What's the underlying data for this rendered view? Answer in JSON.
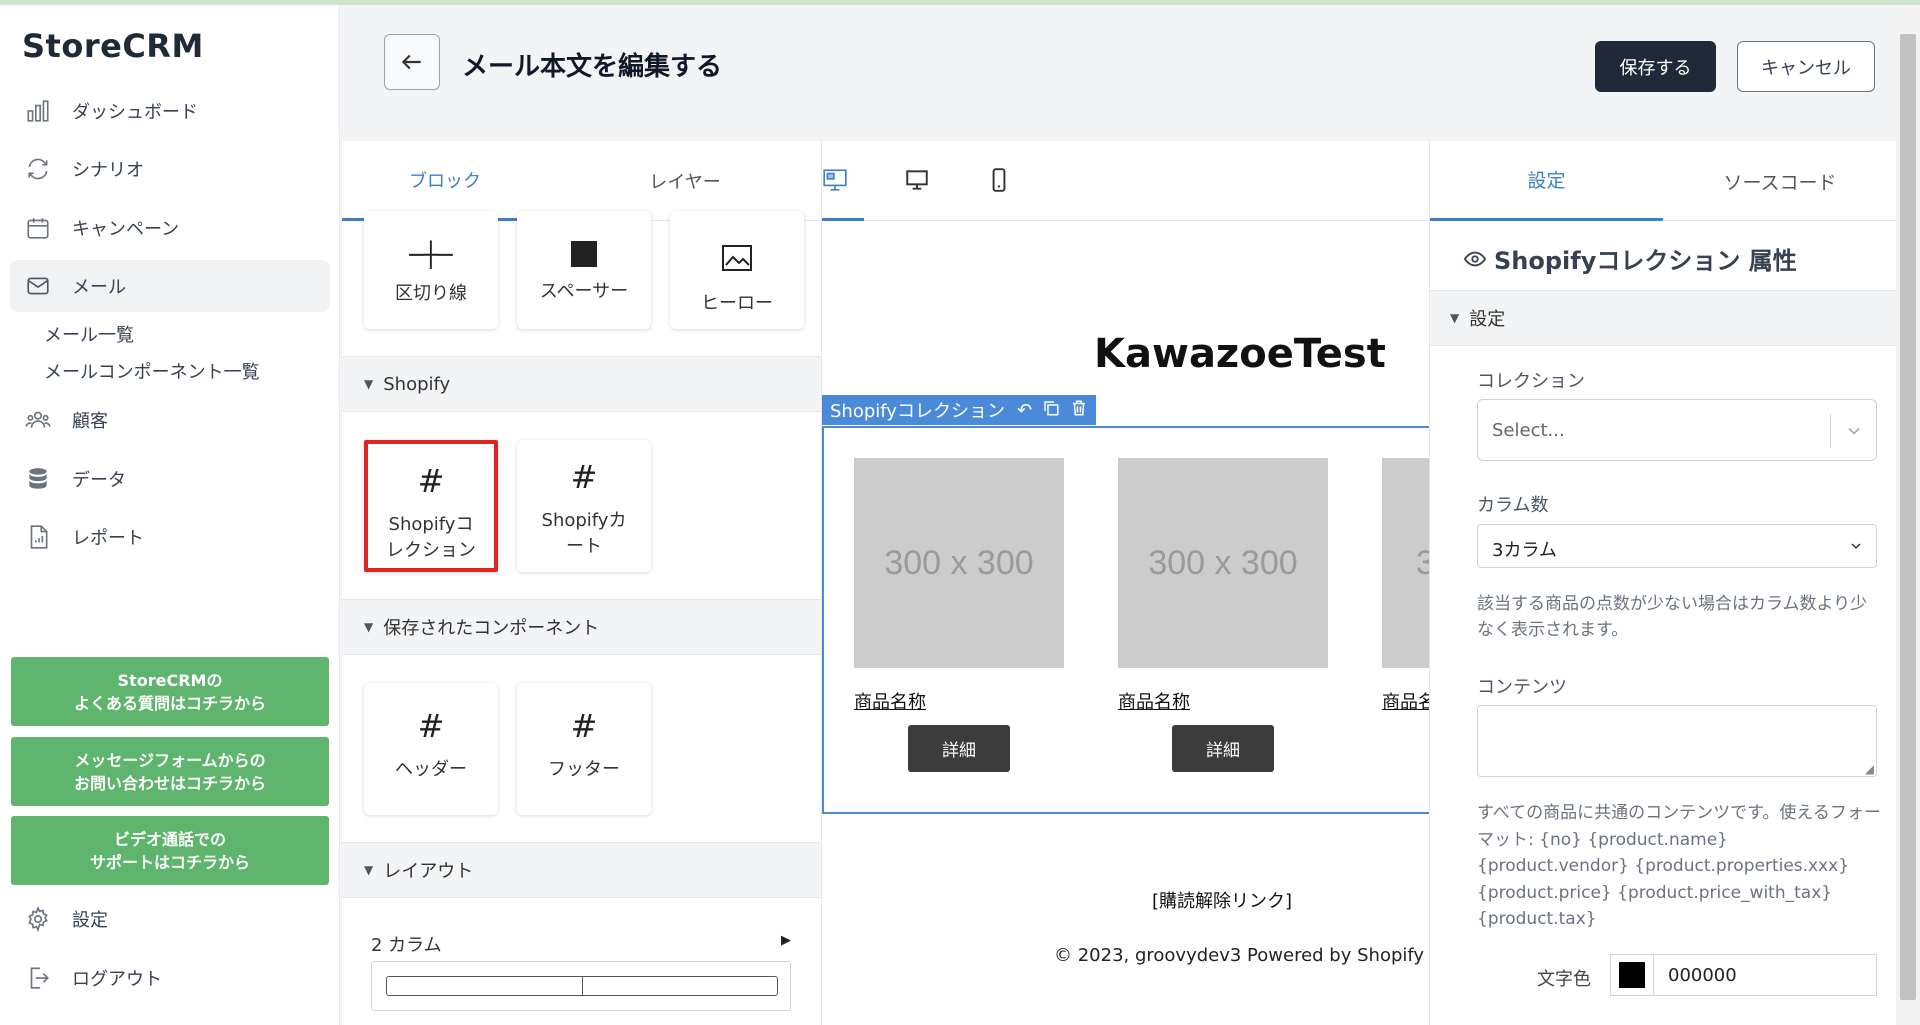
{
  "sidebar": {
    "logo": "StoreCRM",
    "items": [
      {
        "label": "ダッシュボード",
        "icon": "bar-chart-icon"
      },
      {
        "label": "シナリオ",
        "icon": "refresh-icon"
      },
      {
        "label": "キャンペーン",
        "icon": "calendar-icon"
      },
      {
        "label": "メール",
        "icon": "mail-icon"
      },
      {
        "label": "顧客",
        "icon": "users-icon"
      },
      {
        "label": "データ",
        "icon": "database-icon"
      },
      {
        "label": "レポート",
        "icon": "report-icon"
      }
    ],
    "sub_items": [
      "メール一覧",
      "メールコンポーネント一覧"
    ],
    "help_buttons": [
      {
        "line1": "StoreCRMの",
        "line2": "よくある質問はコチラから"
      },
      {
        "line1": "メッセージフォームからの",
        "line2": "お問い合わせはコチラから"
      },
      {
        "line1": "ビデオ通話での",
        "line2": "サポートはコチラから"
      }
    ],
    "settings_label": "設定",
    "logout_label": "ログアウト",
    "accent_color": "#5fb56d"
  },
  "header": {
    "title": "メール本文を編集する",
    "save_label": "保存する",
    "cancel_label": "キャンセル"
  },
  "block_panel": {
    "tabs": [
      "ブロック",
      "レイヤー"
    ],
    "top_blocks": [
      {
        "label": "区切り線",
        "icon": "divider-icon"
      },
      {
        "label": "スペーサー",
        "icon": "spacer-icon"
      },
      {
        "label": "ヒーロー",
        "icon": "hero-image-icon"
      }
    ],
    "shopify_section": "Shopify",
    "shopify_blocks": [
      {
        "line1": "Shopifyコ",
        "line2": "レクション"
      },
      {
        "line1": "Shopifyカ",
        "line2": "ート"
      }
    ],
    "saved_section": "保存されたコンポーネント",
    "saved_blocks": [
      "ヘッダー",
      "フッター"
    ],
    "layout_section": "レイアウト",
    "layout_item": "2 カラム"
  },
  "canvas": {
    "brand": "KawazoeTest",
    "collection_label": "Shopifyコレクション",
    "placeholder": "300 x 300",
    "product_name": "商品名称",
    "product_name_cut": "商品名",
    "detail_label": "詳細",
    "unsubscribe": "[購読解除リンク]",
    "footer": "© 2023, groovydev3 Powered by Shopify"
  },
  "props": {
    "tabs": [
      "設定",
      "ソースコード"
    ],
    "title": "Shopifyコレクション 属性",
    "section": "設定",
    "collection_label": "コレクション",
    "collection_placeholder": "Select...",
    "columns_label": "カラム数",
    "columns_value": "3カラム",
    "columns_help": "該当する商品の点数が少ない場合はカラム数より少なく表示されます。",
    "contents_label": "コンテンツ",
    "contents_help": "すべての商品に共通のコンテンツです。使えるフォーマット: {no} {product.name} {product.vendor} {product.properties.xxx} {product.price} {product.price_with_tax} {product.tax}",
    "text_color_label": "文字色",
    "text_color_value": "000000"
  }
}
